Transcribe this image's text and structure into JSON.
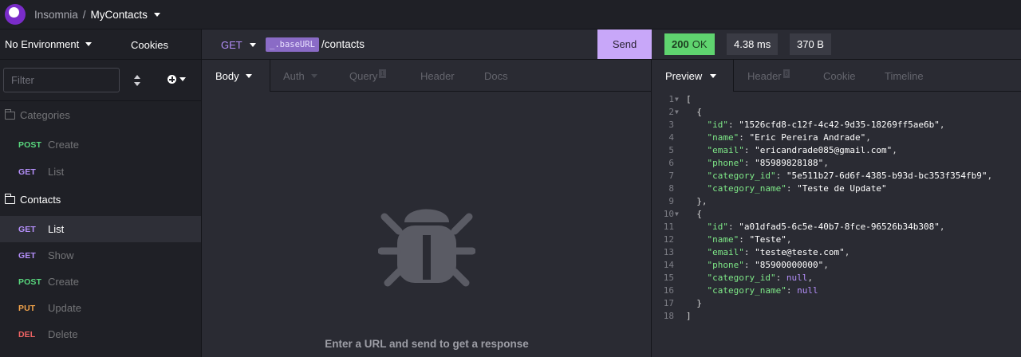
{
  "app": {
    "name": "Insomnia",
    "separator": "/",
    "project": "MyContacts"
  },
  "sidebar": {
    "environment": "No Environment",
    "cookies": "Cookies",
    "filter_placeholder": "Filter",
    "folders": [
      {
        "name": "Categories",
        "items": [
          {
            "method": "POST",
            "name": "Create"
          },
          {
            "method": "GET",
            "name": "List"
          }
        ]
      },
      {
        "name": "Contacts",
        "items": [
          {
            "method": "GET",
            "name": "List"
          },
          {
            "method": "GET",
            "name": "Show"
          },
          {
            "method": "POST",
            "name": "Create"
          },
          {
            "method": "PUT",
            "name": "Update"
          },
          {
            "method": "DEL",
            "name": "Delete"
          }
        ]
      }
    ]
  },
  "request": {
    "method": "GET",
    "url_variable": "_.baseURL",
    "url_path": "/contacts",
    "send_label": "Send",
    "tabs": [
      "Body",
      "Auth",
      "Query",
      "Header",
      "Docs"
    ],
    "query_count": "1",
    "empty_hint": "Enter a URL and send to get a response"
  },
  "response": {
    "status_code": "200",
    "status_text": "OK",
    "time": "4.38 ms",
    "size": "370 B",
    "tabs": [
      "Preview",
      "Header",
      "Cookie",
      "Timeline"
    ],
    "header_count": "8"
  },
  "colors": {
    "post": "#59d87e",
    "get": "#b48ffa",
    "put": "#f2a34a",
    "delete": "#f06464",
    "send": "#c8a7f9",
    "status_ok": "#5fd46f"
  },
  "code_lines": [
    {
      "n": "1",
      "fold": true,
      "html": "["
    },
    {
      "n": "2",
      "fold": true,
      "html": "  {"
    },
    {
      "n": "3",
      "html": "    <span class='k'>\"id\"</span>: <span class='s'>\"1526cfd8-c12f-4c42-9d35-18269ff5ae6b\"</span>,"
    },
    {
      "n": "4",
      "html": "    <span class='k'>\"name\"</span>: <span class='s'>\"Eric Pereira Andrade\"</span>,"
    },
    {
      "n": "5",
      "html": "    <span class='k'>\"email\"</span>: <span class='s'>\"ericandrade085@gmail.com\"</span>,"
    },
    {
      "n": "6",
      "html": "    <span class='k'>\"phone\"</span>: <span class='s'>\"85989828188\"</span>,"
    },
    {
      "n": "7",
      "html": "    <span class='k'>\"category_id\"</span>: <span class='s'>\"5e511b27-6d6f-4385-b93d-bc353f354fb9\"</span>,"
    },
    {
      "n": "8",
      "html": "    <span class='k'>\"category_name\"</span>: <span class='s'>\"Teste de Update\"</span>"
    },
    {
      "n": "9",
      "html": "  },"
    },
    {
      "n": "10",
      "fold": true,
      "html": "  {"
    },
    {
      "n": "11",
      "html": "    <span class='k'>\"id\"</span>: <span class='s'>\"a01dfad5-6c5e-40b7-8fce-96526b34b308\"</span>,"
    },
    {
      "n": "12",
      "html": "    <span class='k'>\"name\"</span>: <span class='s'>\"Teste\"</span>,"
    },
    {
      "n": "13",
      "html": "    <span class='k'>\"email\"</span>: <span class='s'>\"teste@teste.com\"</span>,"
    },
    {
      "n": "14",
      "html": "    <span class='k'>\"phone\"</span>: <span class='s'>\"85900000000\"</span>,"
    },
    {
      "n": "15",
      "html": "    <span class='k'>\"category_id\"</span>: <span class='n'>null</span>,"
    },
    {
      "n": "16",
      "html": "    <span class='k'>\"category_name\"</span>: <span class='n'>null</span>"
    },
    {
      "n": "17",
      "html": "  }"
    },
    {
      "n": "18",
      "html": "]"
    }
  ]
}
